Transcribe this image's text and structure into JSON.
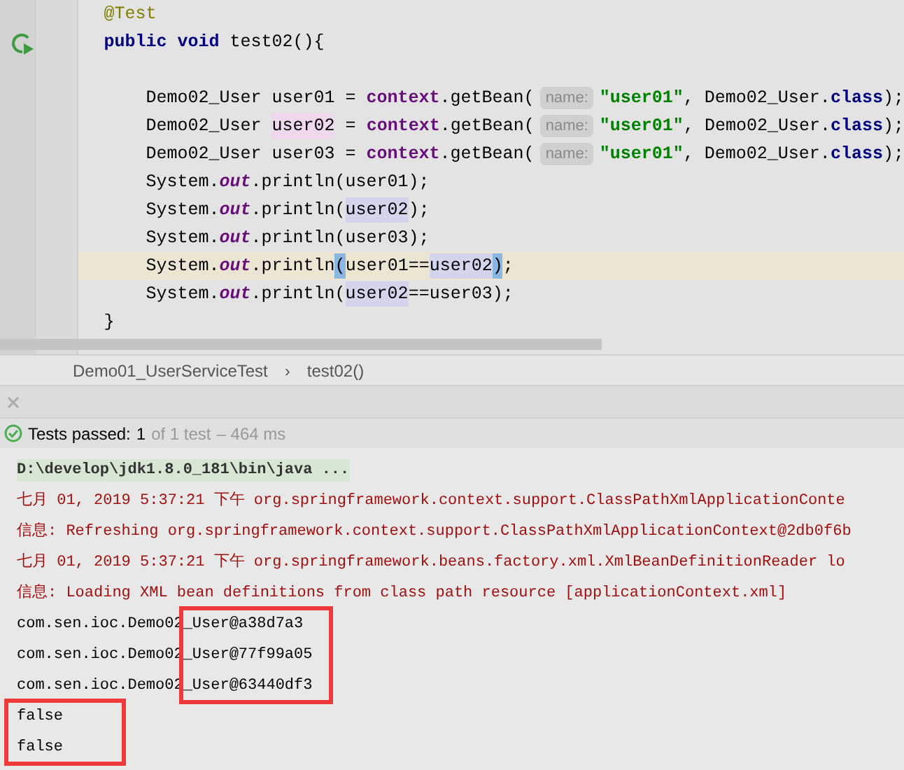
{
  "editor": {
    "lines": [
      {
        "current": false,
        "tokens": [
          {
            "kind": "annotation",
            "text": "@Test"
          }
        ]
      },
      {
        "current": false,
        "tokens": [
          {
            "kind": "keyword",
            "text": "public void"
          },
          {
            "kind": "plain",
            "text": " test02(){"
          }
        ]
      },
      {
        "current": false
      },
      {
        "current": false,
        "tokens": [
          {
            "kind": "plain",
            "text": "    Demo02_User user01 = "
          },
          {
            "kind": "field",
            "text": "context"
          },
          {
            "kind": "plain",
            "text": ".getBean("
          },
          {
            "kind": "hint",
            "text": "name:"
          },
          {
            "kind": "string",
            "text": "\"user01\""
          },
          {
            "kind": "plain",
            "text": ", Demo02_User."
          },
          {
            "kind": "keyword",
            "text": "class"
          },
          {
            "kind": "plain",
            "text": ");"
          }
        ]
      },
      {
        "current": false,
        "tokens": [
          {
            "kind": "plain",
            "text": "    Demo02_User "
          },
          {
            "kind": "write",
            "text": "user02"
          },
          {
            "kind": "plain",
            "text": " = "
          },
          {
            "kind": "field",
            "text": "context"
          },
          {
            "kind": "plain",
            "text": ".getBean("
          },
          {
            "kind": "hint",
            "text": "name:"
          },
          {
            "kind": "string",
            "text": "\"user01\""
          },
          {
            "kind": "plain",
            "text": ", Demo02_User."
          },
          {
            "kind": "keyword",
            "text": "class"
          },
          {
            "kind": "plain",
            "text": ");"
          }
        ]
      },
      {
        "current": false,
        "tokens": [
          {
            "kind": "plain",
            "text": "    Demo02_User user03 = "
          },
          {
            "kind": "field",
            "text": "context"
          },
          {
            "kind": "plain",
            "text": ".getBean("
          },
          {
            "kind": "hint",
            "text": "name:"
          },
          {
            "kind": "string",
            "text": "\"user01\""
          },
          {
            "kind": "plain",
            "text": ", Demo02_User."
          },
          {
            "kind": "keyword",
            "text": "class"
          },
          {
            "kind": "plain",
            "text": ");"
          }
        ]
      },
      {
        "current": false,
        "tokens": [
          {
            "kind": "plain",
            "text": "    System."
          },
          {
            "kind": "static",
            "text": "out"
          },
          {
            "kind": "plain",
            "text": ".println(user01);"
          }
        ]
      },
      {
        "current": false,
        "tokens": [
          {
            "kind": "plain",
            "text": "    System."
          },
          {
            "kind": "static",
            "text": "out"
          },
          {
            "kind": "plain",
            "text": ".println("
          },
          {
            "kind": "read",
            "text": "user02"
          },
          {
            "kind": "plain",
            "text": ");"
          }
        ]
      },
      {
        "current": false,
        "tokens": [
          {
            "kind": "plain",
            "text": "    System."
          },
          {
            "kind": "static",
            "text": "out"
          },
          {
            "kind": "plain",
            "text": ".println(user03);"
          }
        ]
      },
      {
        "current": true,
        "tokens": [
          {
            "kind": "plain",
            "text": "    System."
          },
          {
            "kind": "static",
            "text": "out"
          },
          {
            "kind": "plain",
            "text": ".println"
          },
          {
            "kind": "brace",
            "text": "("
          },
          {
            "kind": "plain",
            "text": "user01=="
          },
          {
            "kind": "read",
            "text": "user02"
          },
          {
            "kind": "brace",
            "text": ")"
          },
          {
            "kind": "plain",
            "text": ";"
          }
        ]
      },
      {
        "current": false,
        "tokens": [
          {
            "kind": "plain",
            "text": "    System."
          },
          {
            "kind": "static",
            "text": "out"
          },
          {
            "kind": "plain",
            "text": ".println("
          },
          {
            "kind": "read",
            "text": "user02"
          },
          {
            "kind": "plain",
            "text": "==user03);"
          }
        ]
      },
      {
        "current": false,
        "tokens": [
          {
            "kind": "plain",
            "text": "}"
          }
        ]
      }
    ]
  },
  "breadcrumb": [
    "Demo01_UserServiceTest",
    "›",
    "test02()"
  ],
  "test_status": {
    "label": "Tests passed:",
    "count": "1",
    "detail": "of 1 test",
    "time": "– 464 ms"
  },
  "console": [
    {
      "kind": "command",
      "text": "D:\\develop\\jdk1.8.0_181\\bin\\java ..."
    },
    {
      "kind": "stderr",
      "text": "七月 01, 2019 5:37:21 下午 org.springframework.context.support.ClassPathXmlApplicationConte"
    },
    {
      "kind": "stderr",
      "text": "信息: Refreshing org.springframework.context.support.ClassPathXmlApplicationContext@2db0f6b"
    },
    {
      "kind": "stderr",
      "text": "七月 01, 2019 5:37:21 下午 org.springframework.beans.factory.xml.XmlBeanDefinitionReader lo"
    },
    {
      "kind": "stderr",
      "text": "信息: Loading XML bean definitions from class path resource [applicationContext.xml]"
    },
    {
      "kind": "object",
      "text": "com.sen.ioc.Demo02_User@a38d7a3",
      "boxed": true
    },
    {
      "kind": "object",
      "text": "com.sen.ioc.Demo02_User@77f99a05",
      "boxed": true
    },
    {
      "kind": "object",
      "text": "com.sen.ioc.Demo02_User@63440df3",
      "boxed": true
    },
    {
      "kind": "boolean",
      "text": "false",
      "boxed": true
    },
    {
      "kind": "boolean",
      "text": "false",
      "boxed": true
    }
  ]
}
